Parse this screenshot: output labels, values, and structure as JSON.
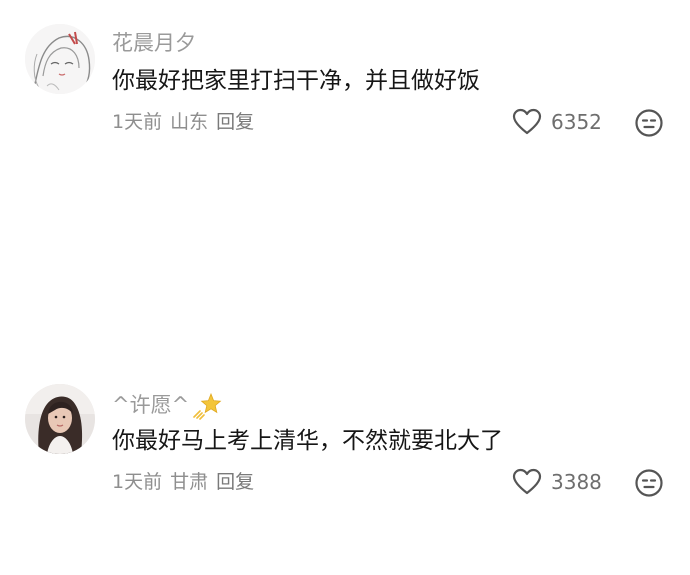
{
  "comments": [
    {
      "username": "花晨月夕",
      "text": "你最好把家里打扫干净，并且做好饭",
      "time": "1天前",
      "location": "山东",
      "reply_label": "回复",
      "likes": "6352",
      "avatar_icon": "sketch-girl-avatar",
      "like_icon": "heart-outline-icon",
      "dislike_icon": "meh-face-icon"
    },
    {
      "username": "^许愿^",
      "username_badge_icon": "sparkle-star-icon",
      "text": "你最好马上考上清华，不然就要北大了",
      "time": "1天前",
      "location": "甘肃",
      "reply_label": "回复",
      "likes": "3388",
      "avatar_icon": "photo-girl-avatar",
      "like_icon": "heart-outline-icon",
      "dislike_icon": "meh-face-icon"
    }
  ],
  "colors": {
    "username": "#9a9a9a",
    "text": "#161616",
    "meta": "#8e8e8e",
    "icon": "#555555",
    "badge": "#f3c53a"
  }
}
